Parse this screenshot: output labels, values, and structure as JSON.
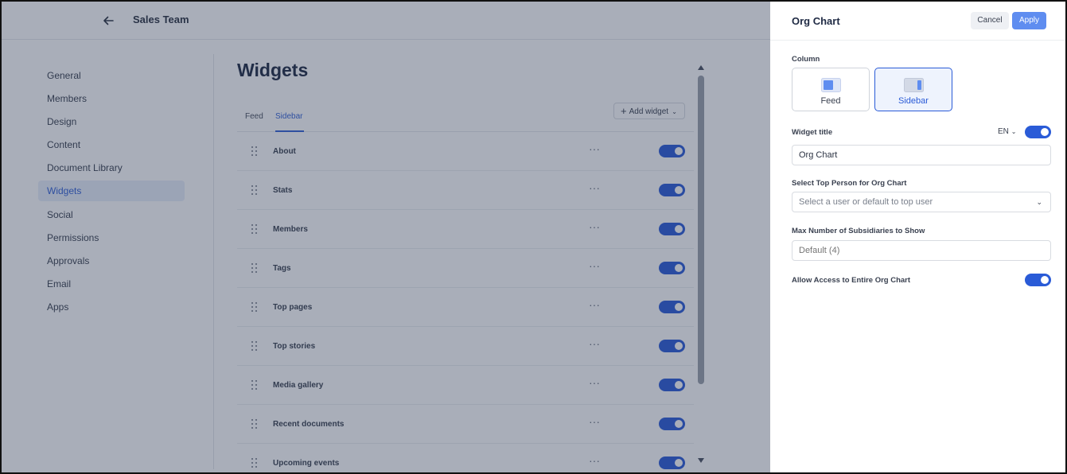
{
  "header": {
    "title": "Sales Team"
  },
  "nav": {
    "items": [
      {
        "label": "General"
      },
      {
        "label": "Members"
      },
      {
        "label": "Design"
      },
      {
        "label": "Content"
      },
      {
        "label": "Document Library"
      },
      {
        "label": "Widgets",
        "active": true
      },
      {
        "label": "Social"
      },
      {
        "label": "Permissions"
      },
      {
        "label": "Approvals"
      },
      {
        "label": "Email"
      },
      {
        "label": "Apps"
      }
    ]
  },
  "main": {
    "title": "Widgets",
    "tabs": [
      {
        "label": "Feed"
      },
      {
        "label": "Sidebar",
        "active": true
      }
    ],
    "add_widget_label": "Add widget",
    "widgets": [
      {
        "label": "About",
        "enabled": true
      },
      {
        "label": "Stats",
        "enabled": true
      },
      {
        "label": "Members",
        "enabled": true
      },
      {
        "label": "Tags",
        "enabled": true
      },
      {
        "label": "Top pages",
        "enabled": true
      },
      {
        "label": "Top stories",
        "enabled": true
      },
      {
        "label": "Media gallery",
        "enabled": true
      },
      {
        "label": "Recent documents",
        "enabled": true
      },
      {
        "label": "Upcoming events",
        "enabled": true
      }
    ]
  },
  "panel": {
    "title": "Org Chart",
    "cancel_label": "Cancel",
    "apply_label": "Apply",
    "column_label": "Column",
    "column_options": [
      {
        "label": "Feed",
        "selected": false
      },
      {
        "label": "Sidebar",
        "selected": true
      }
    ],
    "widget_title_label": "Widget title",
    "language": "EN",
    "widget_title_enabled": true,
    "widget_title_value": "Org Chart",
    "top_person_label": "Select Top Person for Org Chart",
    "top_person_placeholder": "Select a user or default to top user",
    "max_subsidiaries_label": "Max Number of Subsidiaries to Show",
    "max_subsidiaries_placeholder": "Default (4)",
    "allow_access_label": "Allow Access to Entire Org Chart",
    "allow_access_enabled": true
  },
  "colors": {
    "accent": "#2a5bd7",
    "apply_button": "#5f8df0",
    "active_nav_bg": "#e8eefb"
  },
  "icons": {
    "back": "arrow-left-icon",
    "drag": "drag-handle-icon",
    "more": "more-horizontal-icon",
    "add": "plus-icon",
    "chevron": "chevron-down-icon"
  }
}
